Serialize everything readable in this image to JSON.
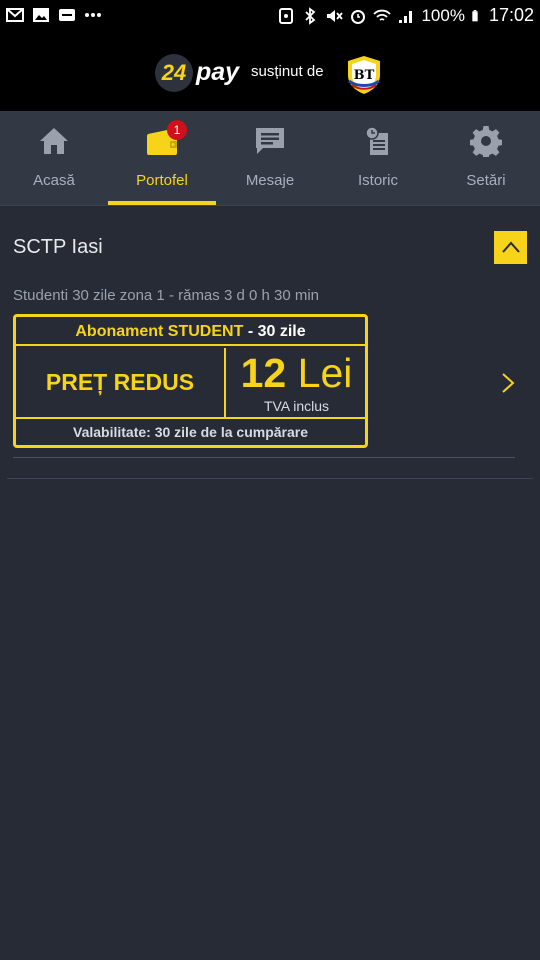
{
  "status_bar": {
    "battery": "100%",
    "time": "17:02"
  },
  "header": {
    "logo_number": "24",
    "logo_text": "pay",
    "sponsor_text": "susținut de",
    "sponsor_logo": "BT"
  },
  "tabs": [
    {
      "label": "Acasă",
      "icon": "home-icon"
    },
    {
      "label": "Portofel",
      "icon": "wallet-icon",
      "badge": "1",
      "active": true
    },
    {
      "label": "Mesaje",
      "icon": "message-icon"
    },
    {
      "label": "Istoric",
      "icon": "history-icon"
    },
    {
      "label": "Setări",
      "icon": "gear-icon"
    }
  ],
  "wallet": {
    "operator": "SCTP Iasi",
    "product_description": "Studenti 30 zile zona 1 - rămas 3 d  0 h 30 min",
    "ticket": {
      "title_highlight": "Abonament STUDENT",
      "title_suffix": "- 30 zile",
      "promo": "PREȚ REDUS",
      "price_value": "12",
      "price_currency": "Lei",
      "vat_note": "TVA inclus",
      "validity": "Valabilitate: 30 zile de la cumpărare"
    }
  },
  "colors": {
    "accent": "#f7d31a",
    "background": "#262b36",
    "tabbar": "#323844",
    "badge": "#d0111b"
  }
}
